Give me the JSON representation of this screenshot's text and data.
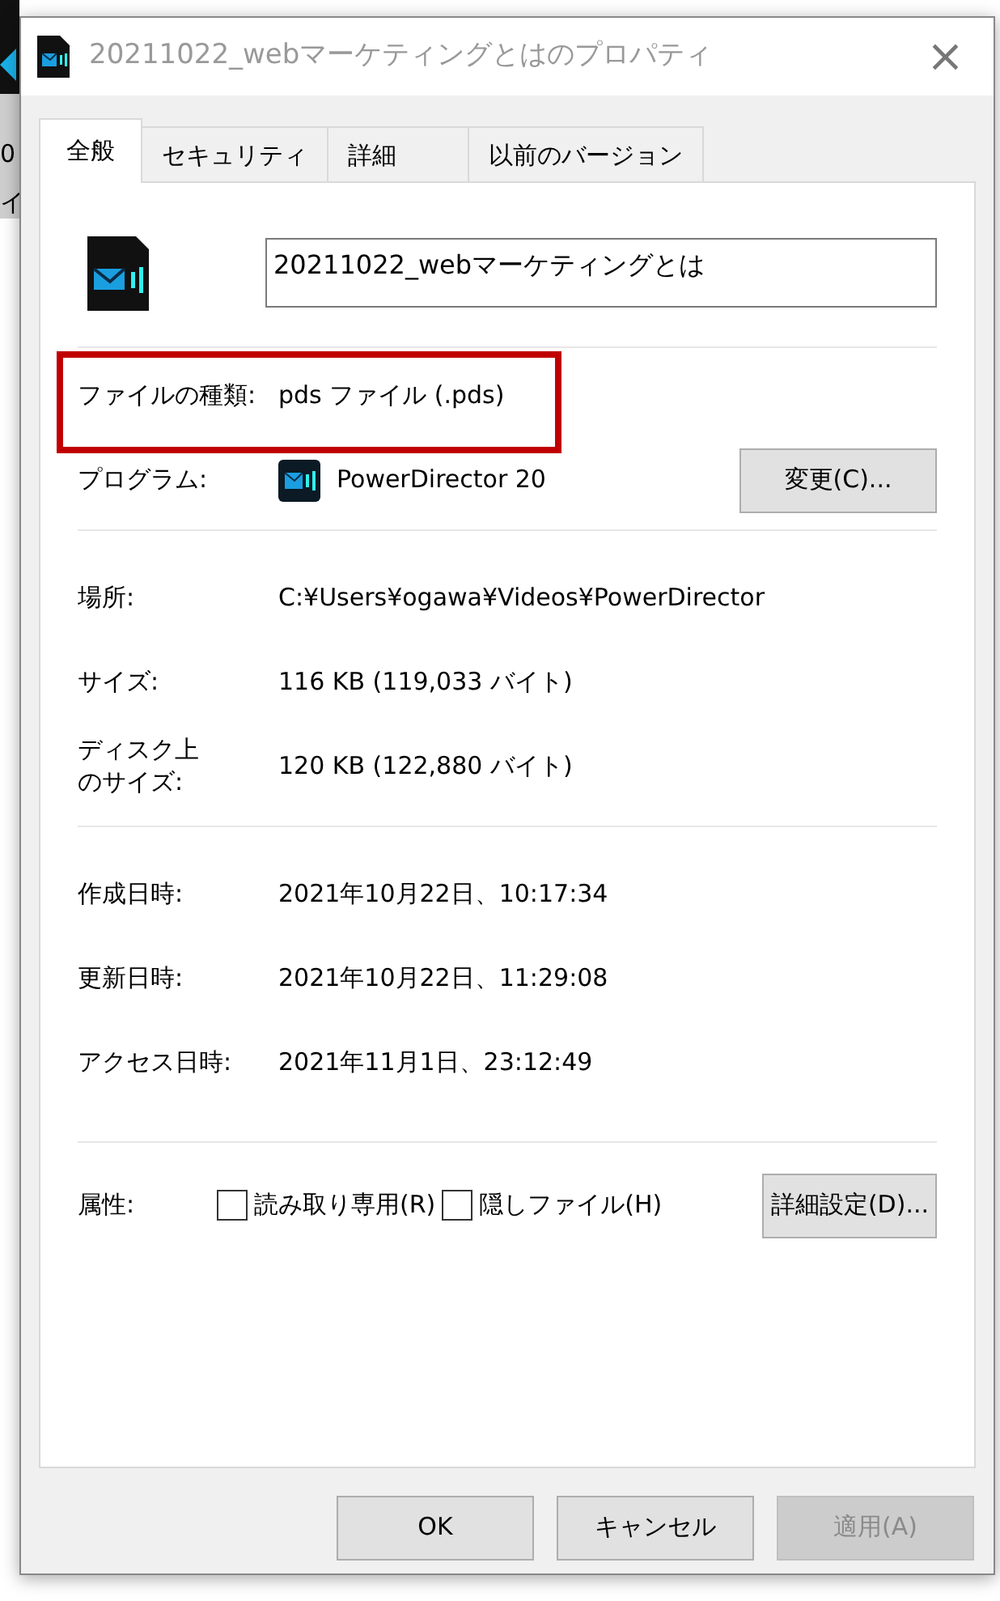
{
  "desktop_icon": {
    "label_lines": [
      "0",
      "イ"
    ],
    "selected": true
  },
  "window": {
    "title": "20211022_webマーケティングとはのプロパティ",
    "close": "×"
  },
  "tabs": [
    {
      "label": "全般",
      "selected": true
    },
    {
      "label": "セキュリティ",
      "selected": false
    },
    {
      "label": "詳細",
      "selected": false
    },
    {
      "label": "以前のバージョン",
      "selected": false
    }
  ],
  "file_name": {
    "value": "20211022_webマーケティングとは"
  },
  "sections": [
    [
      {
        "label": "ファイルの種類:",
        "value": "pds ファイル (.pds)",
        "highlighted": true
      },
      {
        "label": "プログラム:",
        "value": "PowerDirector 20",
        "app_icon": true,
        "button": "変更(C)...",
        "highlighted": false
      }
    ],
    [
      {
        "label": "場所:",
        "value": "C:¥Users¥ogawa¥Videos¥PowerDirector",
        "highlighted": false
      },
      {
        "label": "サイズ:",
        "value": "116 KB (119,033 バイト)",
        "highlighted": false
      },
      {
        "label_lines": [
          "ディスク上",
          "のサイズ:"
        ],
        "value": "120 KB (122,880 バイト)",
        "highlighted": false
      }
    ],
    [
      {
        "label": "作成日時:",
        "value": "2021年10月22日、10:17:34",
        "highlighted": false
      },
      {
        "label": "更新日時:",
        "value": "2021年10月22日、11:29:08",
        "highlighted": false
      },
      {
        "label": "アクセス日時:",
        "value": "2021年11月1日、23:12:49",
        "highlighted": false
      }
    ]
  ],
  "attributes": {
    "label": "属性:",
    "checkboxes": [
      {
        "label": "読み取り専用(R)",
        "checked": false
      },
      {
        "label": "隠しファイル(H)",
        "checked": false
      }
    ],
    "button": "詳細設定(D)..."
  },
  "buttons": [
    {
      "label": "OK",
      "disabled": false
    },
    {
      "label": "キャンセル",
      "disabled": false
    },
    {
      "label": "適用(A)",
      "disabled": true
    }
  ]
}
